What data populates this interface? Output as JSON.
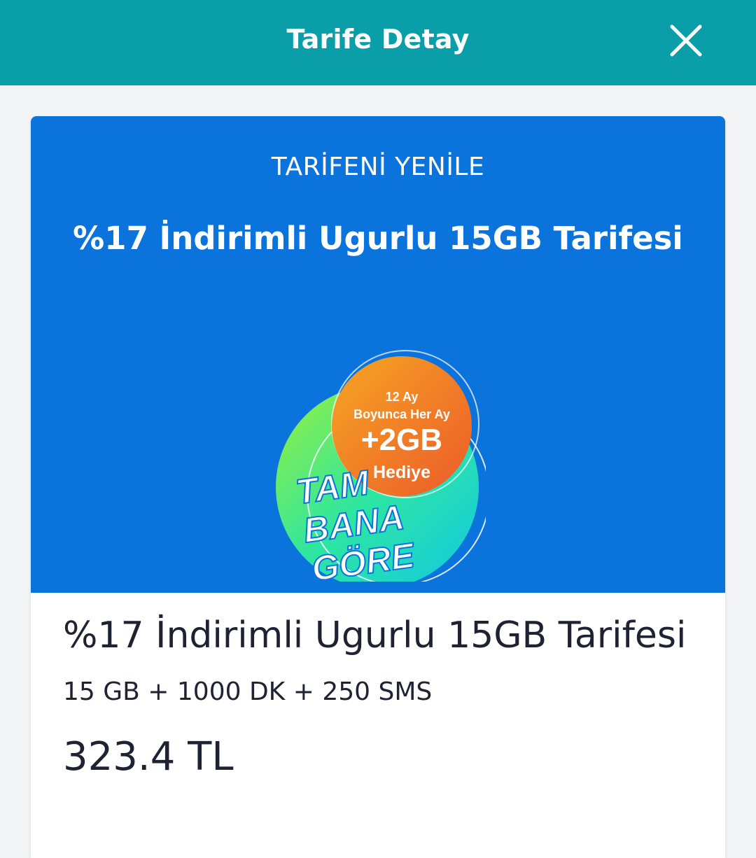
{
  "header": {
    "title": "Tarife Detay",
    "close_icon": "close-icon",
    "background_color": "#0a9ea8"
  },
  "banner": {
    "kicker": "TARİFENİ YENİLE",
    "title": "%17 İndirimli Ugurlu 15GB Tarifesi",
    "background_color": "#0a73dc",
    "promo": {
      "line1": "12 Ay",
      "line2": "Boyunca Her Ay",
      "amount": "+2GB",
      "gift": "Hediye",
      "slogan": [
        "TAM",
        "BANA",
        "GÖRE"
      ]
    }
  },
  "plan": {
    "name": "%17 İndirimli Ugurlu 15GB Tarifesi",
    "features": "15 GB + 1000 DK + 250 SMS",
    "price": "323.4 TL"
  }
}
